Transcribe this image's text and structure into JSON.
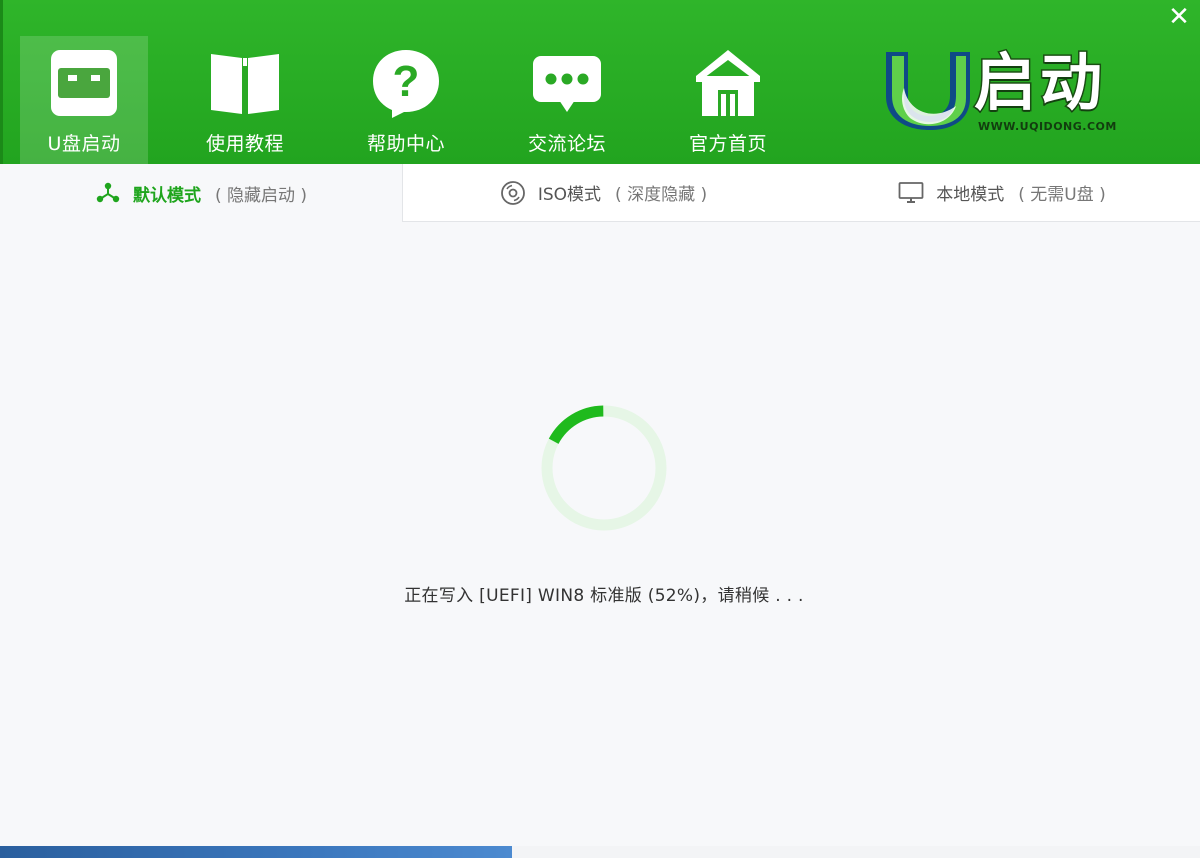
{
  "window": {
    "close_symbol": "✕"
  },
  "nav": {
    "items": [
      {
        "label": "U盘启动",
        "icon": "usb-drive-icon",
        "active": true
      },
      {
        "label": "使用教程",
        "icon": "book-icon",
        "active": false
      },
      {
        "label": "帮助中心",
        "icon": "help-question-icon",
        "active": false
      },
      {
        "label": "交流论坛",
        "icon": "chat-bubble-icon",
        "active": false
      },
      {
        "label": "官方首页",
        "icon": "home-icon",
        "active": false
      }
    ]
  },
  "logo": {
    "text": "启动",
    "url": "WWW.UQIDONG.COM"
  },
  "tabs": [
    {
      "label": "默认模式",
      "sub": "( 隐藏启动 )",
      "icon": "share-nodes-icon",
      "active": true
    },
    {
      "label": "ISO模式",
      "sub": "( 深度隐藏 )",
      "icon": "disc-icon",
      "active": false
    },
    {
      "label": "本地模式",
      "sub": "( 无需U盘 )",
      "icon": "monitor-icon",
      "active": false
    }
  ],
  "progress": {
    "percent": 52,
    "status_text": "正在写入 [UEFI] WIN8 标准版 (52%)，请稍候 . . ."
  },
  "colors": {
    "brand_green": "#22a41f",
    "progress_track": "#e6f6e6",
    "progress_fill": "#1fba1d"
  }
}
